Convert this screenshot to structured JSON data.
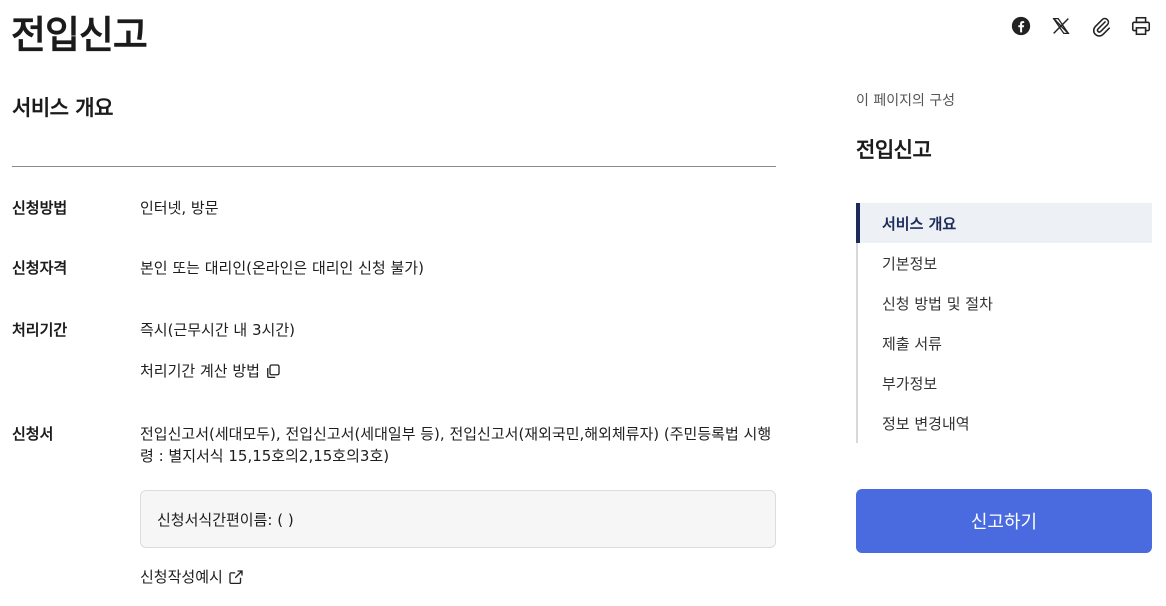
{
  "page": {
    "title": "전입신고"
  },
  "share": {
    "items": [
      {
        "icon": "facebook-icon",
        "label": "facebook"
      },
      {
        "icon": "x-icon",
        "label": "X"
      },
      {
        "icon": "paperclip-icon",
        "label": "link copy"
      },
      {
        "icon": "printer-icon",
        "label": "print"
      }
    ]
  },
  "overview": {
    "title": "서비스 개요",
    "method": {
      "label": "신청방법",
      "value": "인터넷, 방문"
    },
    "eligibility": {
      "label": "신청자격",
      "value": "본인 또는 대리인(온라인은 대리인 신청 불가)"
    },
    "period": {
      "label": "처리기간",
      "value": "즉시(근무시간 내 3시간)",
      "calc_link": "처리기간 계산 방법"
    },
    "form": {
      "label": "신청서",
      "value": "전입신고서(세대모두), 전입신고서(세대일부 등), 전입신고서(재외국민,해외체류자) (주민등록법 시행령 : 별지서식 15,15호의2,15호의3호)",
      "box_text": "신청서식간편이름: ( )",
      "example_link": "신청작성예시"
    }
  },
  "toc": {
    "caption": "이 페이지의 구성",
    "title": "전입신고",
    "items": [
      {
        "label": "서비스 개요",
        "active": true
      },
      {
        "label": "기본정보"
      },
      {
        "label": "신청 방법 및 절차"
      },
      {
        "label": "제출 서류"
      },
      {
        "label": "부가정보"
      },
      {
        "label": "정보 변경내역"
      }
    ]
  },
  "actions": {
    "report_label": "신고하기"
  },
  "colors": {
    "accent": "#4a6be0",
    "toc_active": "#1c2b5a",
    "toc_active_bg": "#edf0f5"
  }
}
